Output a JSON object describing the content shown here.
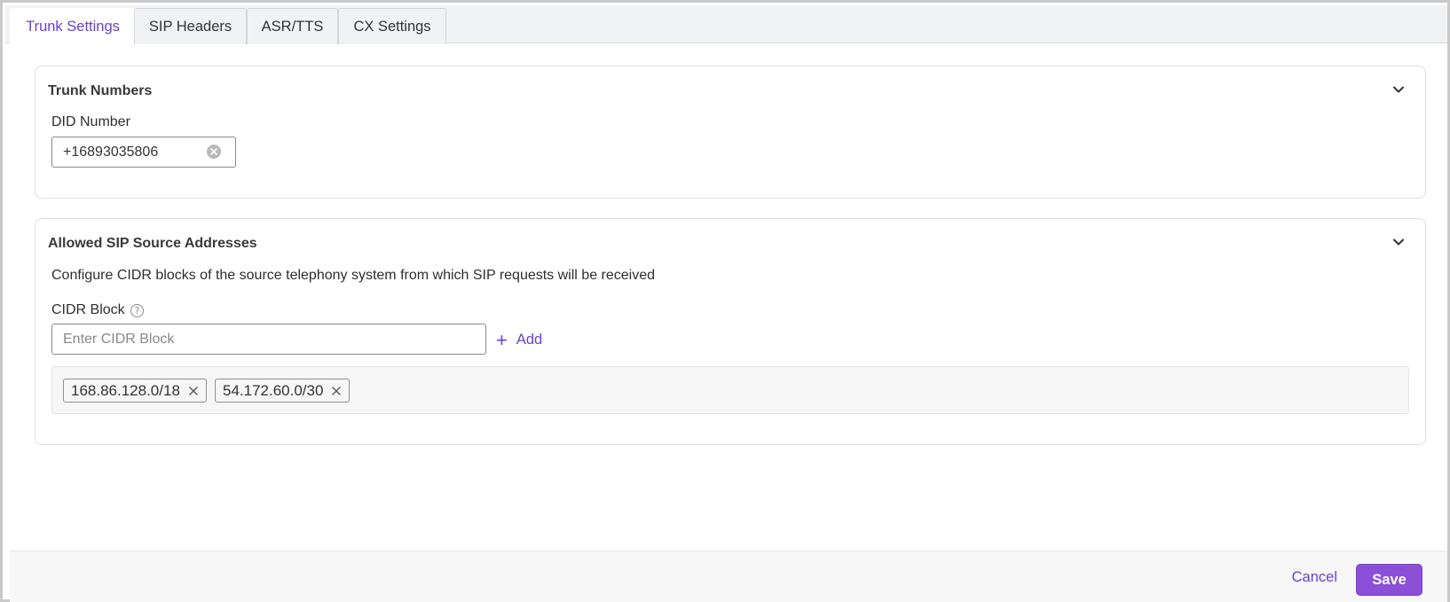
{
  "tabs": [
    {
      "label": "Trunk Settings",
      "active": true
    },
    {
      "label": "SIP Headers",
      "active": false
    },
    {
      "label": "ASR/TTS",
      "active": false
    },
    {
      "label": "CX Settings",
      "active": false
    }
  ],
  "trunk_numbers": {
    "title": "Trunk Numbers",
    "did_label": "DID Number",
    "did_value": "+16893035806"
  },
  "sip_sources": {
    "title": "Allowed SIP Source Addresses",
    "description": "Configure CIDR blocks of the source telephony system from which SIP requests will be received",
    "cidr_label": "CIDR Block",
    "help_glyph": "?",
    "cidr_placeholder": "Enter CIDR Block",
    "add_label": "Add",
    "add_glyph": "+",
    "tags": [
      "168.86.128.0/18",
      "54.172.60.0/30"
    ]
  },
  "footer": {
    "cancel_label": "Cancel",
    "save_label": "Save"
  },
  "colors": {
    "accent": "#6b3fd4",
    "save_button": "#8c4fd8"
  },
  "icons": {
    "chevron": "chevron-down-icon",
    "clear": "clear-circle-icon",
    "help": "help-circle-icon",
    "tag_remove": "close-icon"
  }
}
